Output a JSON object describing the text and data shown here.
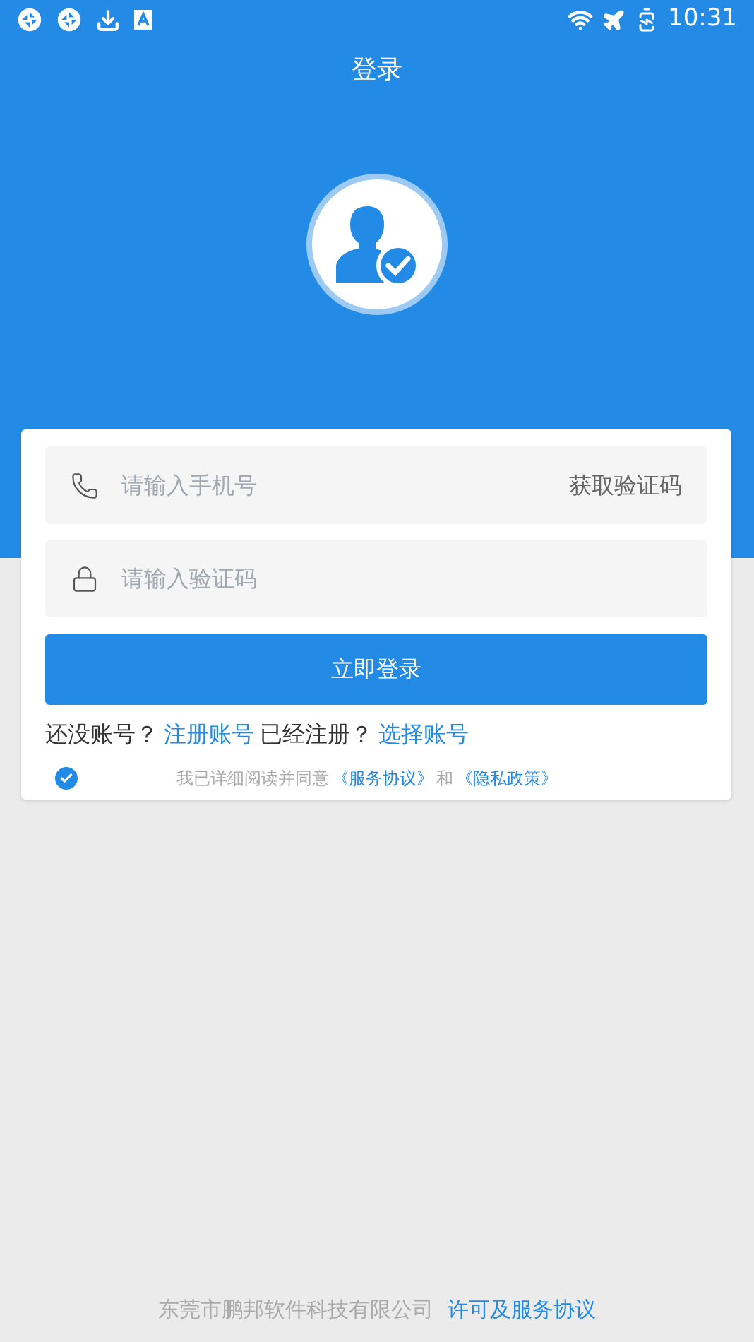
{
  "status_bar": {
    "time": "10:31"
  },
  "header": {
    "title": "登录"
  },
  "form": {
    "phone": {
      "placeholder": "请输入手机号",
      "action": "获取验证码"
    },
    "code": {
      "placeholder": "请输入验证码"
    },
    "submit": "立即登录",
    "links": [
      {
        "kind": "text",
        "text": "还没账号？"
      },
      {
        "kind": "link",
        "text": "注册账号"
      },
      {
        "kind": "text",
        "text": "已经注册？"
      },
      {
        "kind": "link",
        "text": "选择账号"
      }
    ],
    "agreement": {
      "checked": true,
      "parts": [
        {
          "kind": "text",
          "text": "我已详细阅读并同意"
        },
        {
          "kind": "link",
          "text": "《服务协议》"
        },
        {
          "kind": "text",
          "text": "和"
        },
        {
          "kind": "link",
          "text": "《隐私政策》"
        }
      ]
    }
  },
  "footer": {
    "company": "东莞市鹏邦软件科技有限公司",
    "link": "许可及服务协议"
  }
}
